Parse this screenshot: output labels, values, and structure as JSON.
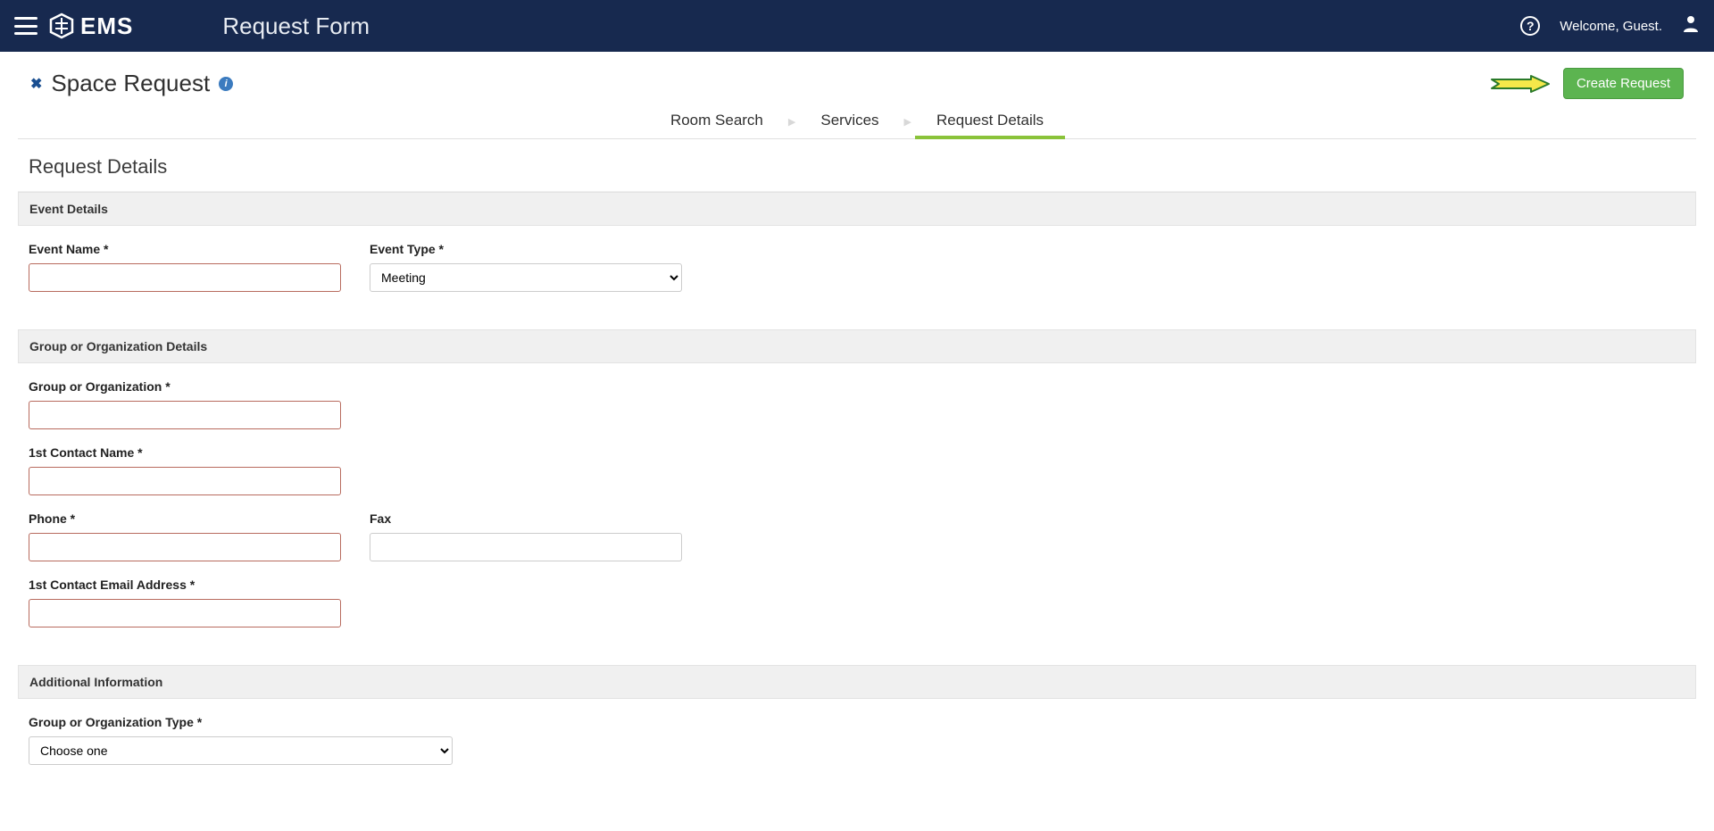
{
  "header": {
    "brand": "EMS",
    "page_title": "Request Form",
    "welcome": "Welcome, Guest."
  },
  "titlebar": {
    "close_glyph": "✖",
    "title": "Space Request",
    "info_glyph": "i",
    "create_btn": "Create Request"
  },
  "tabs": {
    "room_search": "Room Search",
    "services": "Services",
    "request_details": "Request Details",
    "sep": "▶"
  },
  "section_title": "Request Details",
  "panels": {
    "event_details": {
      "header": "Event Details",
      "event_name_label": "Event Name *",
      "event_type_label": "Event Type *",
      "event_type_value": "Meeting"
    },
    "group_details": {
      "header": "Group or Organization Details",
      "group_label": "Group or Organization *",
      "contact_name_label": "1st Contact Name *",
      "phone_label": "Phone *",
      "fax_label": "Fax",
      "email_label": "1st Contact Email Address *"
    },
    "additional": {
      "header": "Additional Information",
      "group_type_label": "Group or Organization Type *",
      "group_type_value": "Choose one"
    }
  }
}
